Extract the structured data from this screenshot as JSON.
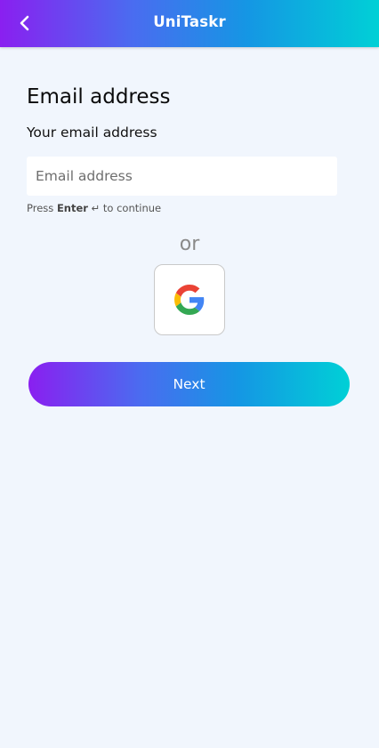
{
  "header": {
    "title": "UniTaskr",
    "back_icon": "chevron-left-icon"
  },
  "form": {
    "heading": "Email address",
    "label": "Your email address",
    "email_placeholder": "Email address",
    "email_value": "",
    "hint_prefix": "Press",
    "hint_key": "Enter",
    "hint_symbol": "↵",
    "hint_suffix": "to continue",
    "divider_text": "or",
    "google_icon": "google-icon",
    "next_label": "Next"
  },
  "colors": {
    "gradient_start": "#8a1ff0",
    "gradient_end": "#00d0d6",
    "background": "#f1f6fd"
  }
}
